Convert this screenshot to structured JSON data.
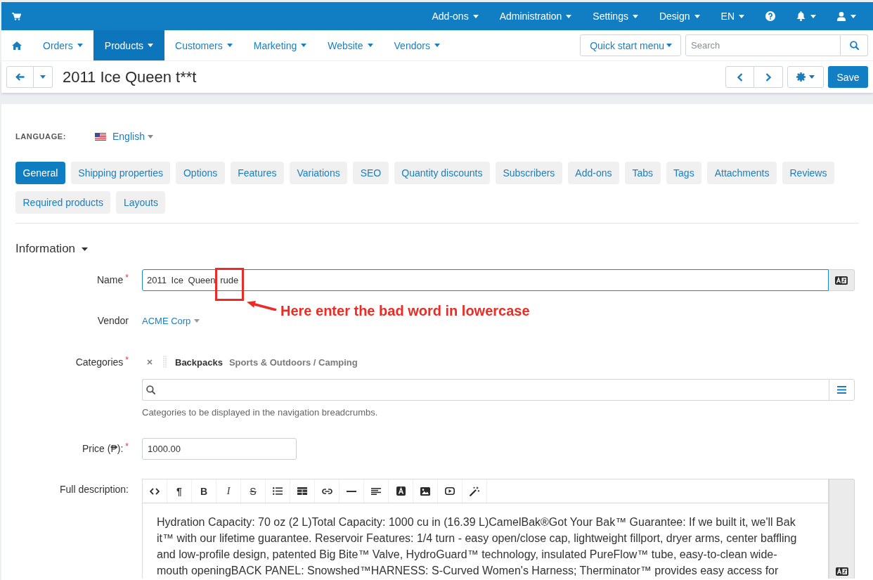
{
  "top_bar": {
    "menus": [
      {
        "label": "Add-ons"
      },
      {
        "label": "Administration"
      },
      {
        "label": "Settings"
      },
      {
        "label": "Design"
      },
      {
        "label": "EN"
      }
    ]
  },
  "main_nav": {
    "items": [
      {
        "label": "Orders",
        "selected": false
      },
      {
        "label": "Products",
        "selected": true
      },
      {
        "label": "Customers",
        "selected": false
      },
      {
        "label": "Marketing",
        "selected": false
      },
      {
        "label": "Website",
        "selected": false
      },
      {
        "label": "Vendors",
        "selected": false
      }
    ],
    "quick_start": "Quick start menu",
    "search": {
      "placeholder": "Search"
    }
  },
  "header": {
    "title": "2011 Ice Queen t**t",
    "save_button": "Save"
  },
  "language": {
    "label": "LANGUAGE:",
    "value": "English"
  },
  "tabs": [
    {
      "label": "General",
      "selected": true
    },
    {
      "label": "Shipping properties",
      "selected": false
    },
    {
      "label": "Options",
      "selected": false
    },
    {
      "label": "Features",
      "selected": false
    },
    {
      "label": "Variations",
      "selected": false
    },
    {
      "label": "SEO",
      "selected": false
    },
    {
      "label": "Quantity discounts",
      "selected": false
    },
    {
      "label": "Subscribers",
      "selected": false
    },
    {
      "label": "Add-ons",
      "selected": false
    },
    {
      "label": "Tabs",
      "selected": false
    },
    {
      "label": "Tags",
      "selected": false
    },
    {
      "label": "Attachments",
      "selected": false
    },
    {
      "label": "Reviews",
      "selected": false
    },
    {
      "label": "Required products",
      "selected": false
    },
    {
      "label": "Layouts",
      "selected": false
    }
  ],
  "section": {
    "title": "Information",
    "expanded": true
  },
  "form": {
    "name": {
      "label": "Name",
      "required_mark": "*",
      "value": "2011 Ice Queen rude",
      "focused": true
    },
    "vendor": {
      "label": "Vendor",
      "value": "ACME Corp"
    },
    "categories": {
      "label": "Categories",
      "required_mark": "*",
      "items": [
        {
          "name": "Backpacks",
          "path": "Sports & Outdoors / Camping"
        }
      ],
      "help": "Categories to be displayed in the navigation breadcrumbs."
    },
    "price": {
      "label": "Price (₱):",
      "required_mark": "*",
      "value": "1000.00"
    },
    "full_description": {
      "label": "Full description:",
      "toolbar": [
        {
          "kind": "html"
        },
        {
          "kind": "formatting",
          "glyph": "¶"
        },
        {
          "kind": "bold",
          "glyph": "B"
        },
        {
          "kind": "italic",
          "glyph": "I"
        },
        {
          "kind": "deleted",
          "glyph": "S"
        },
        {
          "kind": "unorderedlist"
        },
        {
          "kind": "table"
        },
        {
          "kind": "link"
        },
        {
          "kind": "line"
        },
        {
          "kind": "alignment"
        },
        {
          "kind": "fontcolor"
        },
        {
          "kind": "image"
        },
        {
          "kind": "video"
        },
        {
          "kind": "magic"
        }
      ],
      "text": "Hydration Capacity: 70 oz (2 L)Total Capacity: 1000 cu in (16.39 L)CamelBak®Got Your Bak™ Guarantee: If we built it, we'll Bak it™ with our lifetime guarantee. Reservoir Features: 1/4 turn - easy open/close cap, lightweight fillport, dryer arms, center baffling and low-profile design, patented Big Bite™ Valve, HydroGuard™ technology, insulated PureFlow™ tube, easy-to-clean wide-mouth openingBACK PANEL: Snowshed™HARNESS: S-Curved Women's Harness; Therminator™ provides easy access for"
    }
  },
  "annotation": {
    "text": "Here enter the bad word in lowercase"
  }
}
